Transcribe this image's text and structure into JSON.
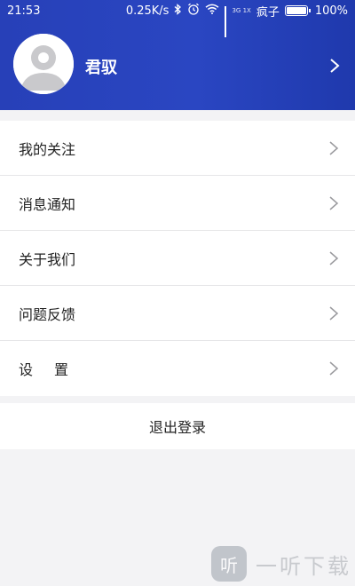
{
  "status_bar": {
    "time": "21:53",
    "speed": "0.25K/s",
    "net_type_top": "3G",
    "net_type_bottom": "1X",
    "carrier": "疯子",
    "battery": "100%",
    "icons": [
      "bluetooth-icon",
      "alarm-icon",
      "wifi-icon",
      "signal-icon",
      "battery-icon"
    ]
  },
  "profile": {
    "username": "君驭",
    "avatar_icon": "default-avatar-icon",
    "arrow_icon": "chevron-right-icon"
  },
  "menu": {
    "items": [
      {
        "label": "我的关注"
      },
      {
        "label": "消息通知"
      },
      {
        "label": "关于我们"
      },
      {
        "label": "问题反馈"
      },
      {
        "label": "设置"
      }
    ]
  },
  "logout": {
    "label": "退出登录"
  },
  "watermark": {
    "logo_glyph": "听",
    "text": "一听下载"
  },
  "colors": {
    "header_blue": "#2a44c0",
    "background": "#f3f3f5",
    "divider": "#e6e6e8"
  }
}
